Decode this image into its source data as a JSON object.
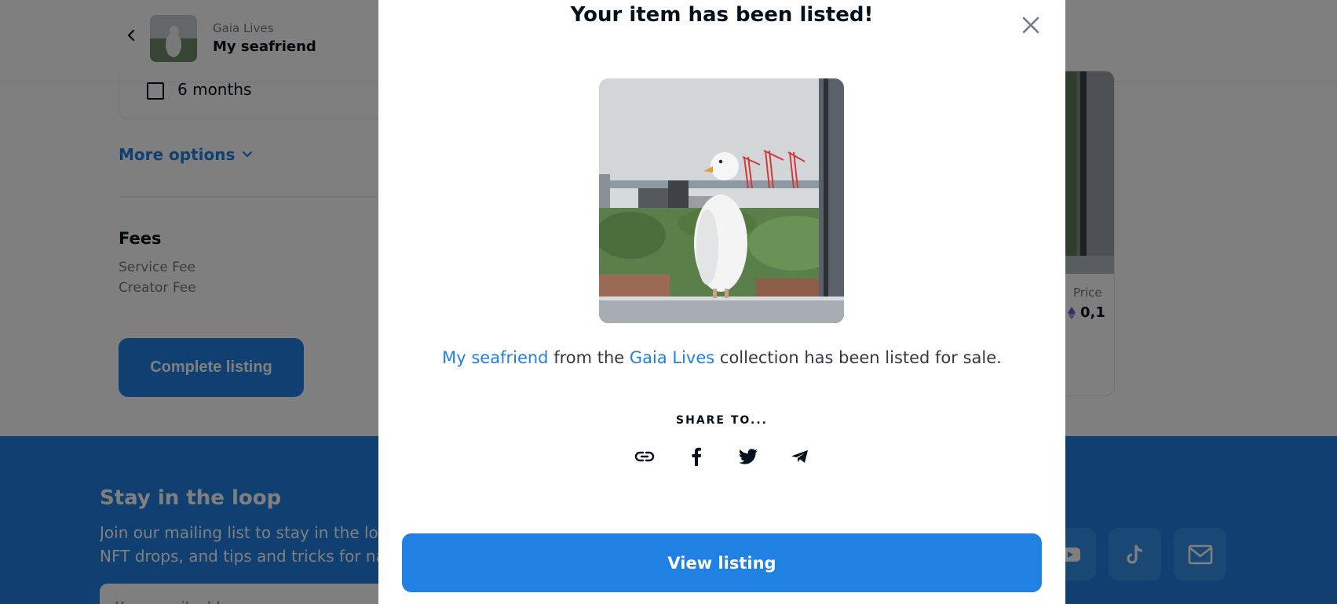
{
  "header": {
    "collection_name": "Gaia Lives",
    "item_name": "My seafriend"
  },
  "listing_form": {
    "duration_label": "6 months",
    "more_options_label": "More options",
    "fees_title": "Fees",
    "service_fee_label": "Service Fee",
    "creator_fee_label": "Creator Fee",
    "complete_button_label": "Complete listing"
  },
  "preview_card": {
    "price_label": "Price",
    "price_value": "0,1"
  },
  "footer": {
    "title": "Stay in the loop",
    "text_line1": "Join our mailing list to stay in the loop",
    "text_line2": "NFT drops, and tips and tricks for na",
    "email_placeholder": "Your email address"
  },
  "modal": {
    "title": "Your item has been listed!",
    "item_link": "My seafriend",
    "message_middle": " from the ",
    "collection_link": "Gaia Lives",
    "message_end": " collection has been listed for sale.",
    "share_label": "SHARE TO...",
    "view_button_label": "View listing"
  },
  "icons": {
    "share": [
      "link-icon",
      "facebook-icon",
      "twitter-icon",
      "telegram-icon"
    ],
    "social": [
      "youtube-icon",
      "tiktok-icon",
      "mail-icon"
    ]
  },
  "colors": {
    "accent": "#2081e2",
    "text": "#04111d",
    "muted": "#707a83"
  }
}
